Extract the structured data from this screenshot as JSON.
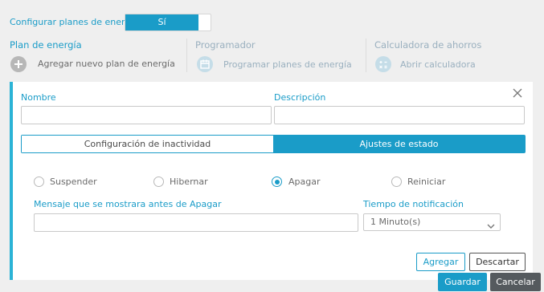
{
  "header": {
    "configure_label": "Configurar planes de energía",
    "toggle_value": "Sí"
  },
  "sections": {
    "plan_title": "Plan de energía",
    "plan_action": "Agregar nuevo plan de energía",
    "scheduler_title": "Programador",
    "scheduler_action": "Programar planes de energía",
    "calculator_title": "Calculadora de ahorros",
    "calculator_action": "Abrir calculadora"
  },
  "form": {
    "name_label": "Nombre",
    "name_value": "",
    "description_label": "Descripción",
    "description_value": "",
    "tabs": [
      {
        "label": "Configuración de inactividad",
        "active": false
      },
      {
        "label": "Ajustes de estado",
        "active": true
      }
    ],
    "radios": [
      {
        "label": "Suspender",
        "checked": false
      },
      {
        "label": "Hibernar",
        "checked": false
      },
      {
        "label": "Apagar",
        "checked": true
      },
      {
        "label": "Reiniciar",
        "checked": false
      }
    ],
    "message_label": "Mensaje que se mostrara antes de Apagar",
    "message_value": "",
    "notification_label": "Tiempo de notificación",
    "notification_value": "1 Minuto(s)",
    "add_button": "Agregar",
    "discard_button": "Descartar"
  },
  "footer": {
    "save_button": "Guardar",
    "cancel_button": "Cancelar"
  },
  "colors": {
    "accent": "#1a9cc8",
    "panel_border": "#2bb3d6",
    "cancel_bg": "#555a5e"
  }
}
